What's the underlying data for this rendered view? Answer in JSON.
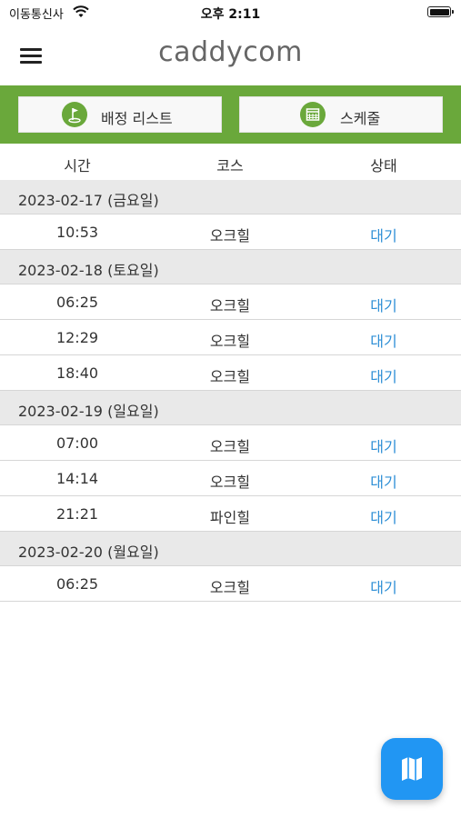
{
  "status_bar": {
    "carrier": "이동통신사",
    "time": "오후 2:11"
  },
  "header": {
    "logo": "caddycom"
  },
  "actions": {
    "assignment_list": "배정 리스트",
    "schedule": "스케줄"
  },
  "columns": {
    "time": "시간",
    "course": "코스",
    "status": "상태"
  },
  "groups": [
    {
      "date": "2023-02-17 (금요일)",
      "items": [
        {
          "time": "10:53",
          "course": "오크힐",
          "status": "대기"
        }
      ]
    },
    {
      "date": "2023-02-18 (토요일)",
      "items": [
        {
          "time": "06:25",
          "course": "오크힐",
          "status": "대기"
        },
        {
          "time": "12:29",
          "course": "오크힐",
          "status": "대기"
        },
        {
          "time": "18:40",
          "course": "오크힐",
          "status": "대기"
        }
      ]
    },
    {
      "date": "2023-02-19 (일요일)",
      "items": [
        {
          "time": "07:00",
          "course": "오크힐",
          "status": "대기"
        },
        {
          "time": "14:14",
          "course": "오크힐",
          "status": "대기"
        },
        {
          "time": "21:21",
          "course": "파인힐",
          "status": "대기"
        }
      ]
    },
    {
      "date": "2023-02-20 (월요일)",
      "items": [
        {
          "time": "06:25",
          "course": "오크힐",
          "status": "대기"
        }
      ]
    }
  ],
  "colors": {
    "accent_green": "#6aa83b",
    "status_blue": "#2e8fd6",
    "fab_blue": "#2196f3"
  },
  "icons": {
    "menu": "hamburger-icon",
    "assignment": "golf-flag-icon",
    "schedule": "calendar-icon",
    "fab": "map-icon"
  }
}
